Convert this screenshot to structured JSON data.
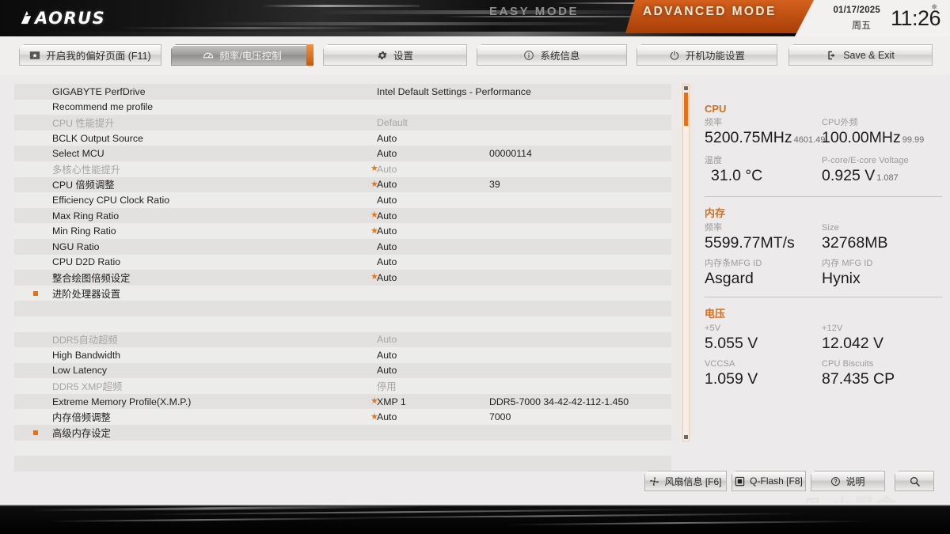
{
  "header": {
    "logo": "AORUS",
    "easy_mode": "EASY MODE",
    "advanced_mode": "ADVANCED MODE",
    "date": "01/17/2025",
    "weekday": "周五",
    "time": "11:26",
    "gear_icon": "gear-icon"
  },
  "nav": {
    "tabs": [
      {
        "label": "开启我的偏好页面 (F11)",
        "icon": "favorite-page-icon",
        "active": false
      },
      {
        "label": "频率/电压控制",
        "icon": "tweaker-icon",
        "active": true
      },
      {
        "label": "设置",
        "icon": "gear-icon",
        "active": false
      },
      {
        "label": "系统信息",
        "icon": "info-icon",
        "active": false
      },
      {
        "label": "开机功能设置",
        "icon": "power-icon",
        "active": false
      },
      {
        "label": "Save & Exit",
        "icon": "exit-icon",
        "active": false
      }
    ]
  },
  "settings": {
    "rows": [
      {
        "label": "GIGABYTE PerfDrive",
        "value": "Intel Default Settings - Performance",
        "extra": "",
        "star": false,
        "dim": false,
        "submenu": false
      },
      {
        "label": "Recommend me profile",
        "value": "",
        "extra": "",
        "star": false,
        "dim": false,
        "submenu": false
      },
      {
        "label": "CPU 性能提升",
        "value": "Default",
        "extra": "",
        "star": false,
        "dim": true,
        "submenu": false
      },
      {
        "label": "BCLK Output Source",
        "value": "Auto",
        "extra": "",
        "star": false,
        "dim": false,
        "submenu": false
      },
      {
        "label": "Select MCU",
        "value": "Auto",
        "extra": "00000114",
        "star": false,
        "dim": false,
        "submenu": false
      },
      {
        "label": "多核心性能提升",
        "value": "Auto",
        "extra": "",
        "star": true,
        "dim": true,
        "submenu": false
      },
      {
        "label": "CPU 倍频调整",
        "value": "Auto",
        "extra": "39",
        "star": true,
        "dim": false,
        "submenu": false
      },
      {
        "label": "Efficiency CPU Clock Ratio",
        "value": "Auto",
        "extra": "",
        "star": false,
        "dim": false,
        "submenu": false
      },
      {
        "label": "Max Ring Ratio",
        "value": "Auto",
        "extra": "",
        "star": true,
        "dim": false,
        "submenu": false
      },
      {
        "label": "Min Ring Ratio",
        "value": "Auto",
        "extra": "",
        "star": true,
        "dim": false,
        "submenu": false
      },
      {
        "label": "NGU Ratio",
        "value": "Auto",
        "extra": "",
        "star": false,
        "dim": false,
        "submenu": false
      },
      {
        "label": "CPU D2D Ratio",
        "value": "Auto",
        "extra": "",
        "star": false,
        "dim": false,
        "submenu": false
      },
      {
        "label": "整合绘图倍频设定",
        "value": "Auto",
        "extra": "",
        "star": true,
        "dim": false,
        "submenu": false
      },
      {
        "label": "进阶处理器设置",
        "value": "",
        "extra": "",
        "star": false,
        "dim": false,
        "submenu": true
      },
      {
        "label": "",
        "value": "",
        "extra": "",
        "star": false,
        "dim": false,
        "submenu": false
      },
      {
        "label": "",
        "value": "",
        "extra": "",
        "star": false,
        "dim": false,
        "submenu": false
      },
      {
        "label": "DDR5自动超频",
        "value": "Auto",
        "extra": "",
        "star": false,
        "dim": true,
        "submenu": false
      },
      {
        "label": "High Bandwidth",
        "value": "Auto",
        "extra": "",
        "star": false,
        "dim": false,
        "submenu": false
      },
      {
        "label": "Low Latency",
        "value": "Auto",
        "extra": "",
        "star": false,
        "dim": false,
        "submenu": false
      },
      {
        "label": "DDR5 XMP超频",
        "value": "停用",
        "extra": "",
        "star": false,
        "dim": true,
        "submenu": false
      },
      {
        "label": "Extreme Memory Profile(X.M.P.)",
        "value": "XMP 1",
        "extra": "DDR5-7000 34-42-42-112-1.450",
        "star": true,
        "dim": false,
        "submenu": false
      },
      {
        "label": "内存倍频调整",
        "value": "Auto",
        "extra": "7000",
        "star": true,
        "dim": false,
        "submenu": false
      },
      {
        "label": "高级内存设定",
        "value": "",
        "extra": "",
        "star": false,
        "dim": false,
        "submenu": true
      },
      {
        "label": "",
        "value": "",
        "extra": "",
        "star": false,
        "dim": false,
        "submenu": false
      },
      {
        "label": "",
        "value": "",
        "extra": "",
        "star": false,
        "dim": false,
        "submenu": false
      }
    ]
  },
  "info_panel": {
    "groups": [
      {
        "title": "CPU",
        "cells": [
          {
            "key": "频率",
            "value": "5200.75MHz",
            "sub": "4601.49",
            "col": 0
          },
          {
            "key": "CPU外频",
            "value": "100.00MHz",
            "sub": "99.99",
            "col": 1
          },
          {
            "key": "温度",
            "value": "31.0 °C",
            "sub": "",
            "col": 0,
            "indent": true
          },
          {
            "key": "P-core/E-core Voltage",
            "value": "0.925 V",
            "sub": "1.087",
            "col": 1
          }
        ]
      },
      {
        "title": "内存",
        "cells": [
          {
            "key": "频率",
            "value": "5599.77MT/s",
            "sub": "",
            "col": 0
          },
          {
            "key": "Size",
            "value": "32768MB",
            "sub": "",
            "col": 1
          },
          {
            "key": "内存条MFG ID",
            "value": "Asgard",
            "sub": "",
            "col": 0
          },
          {
            "key": "内存 MFG ID",
            "value": "Hynix",
            "sub": "",
            "col": 1
          }
        ]
      },
      {
        "title": "电压",
        "cells": [
          {
            "key": "+5V",
            "value": "5.055 V",
            "sub": "",
            "col": 0
          },
          {
            "key": "+12V",
            "value": "12.042 V",
            "sub": "",
            "col": 1
          },
          {
            "key": "VCCSA",
            "value": "1.059 V",
            "sub": "",
            "col": 0
          },
          {
            "key": "CPU Biscuits",
            "value": "87.435 CP",
            "sub": "",
            "col": 1
          }
        ]
      }
    ]
  },
  "bottom_buttons": [
    {
      "label": "风扇信息 [F6]",
      "icon": "fan-icon"
    },
    {
      "label": "Q-Flash [F8]",
      "icon": "qflash-icon"
    },
    {
      "label": "说明",
      "icon": "help-icon"
    },
    {
      "label": "",
      "icon": "search-icon"
    }
  ],
  "watermark": {
    "text": "小黑盒"
  },
  "colors": {
    "accent_orange": "#e2711d",
    "advanced_mode_bg": "#c45508",
    "panel_bg": "#ebeae9",
    "row_odd": "#e2e1e0",
    "row_even": "#ececeb",
    "dim_text": "#a7a5a4"
  }
}
